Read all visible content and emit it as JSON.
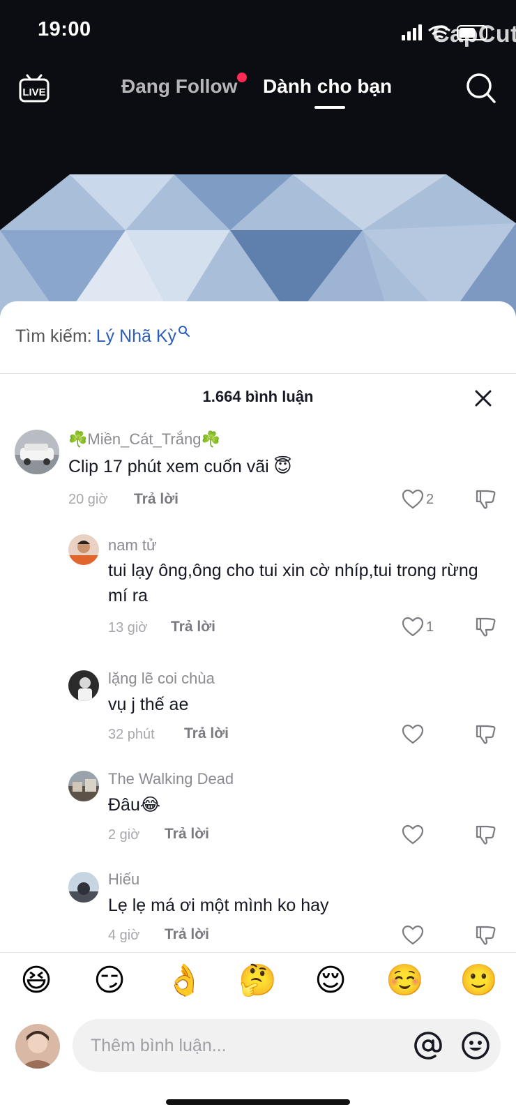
{
  "status_bar": {
    "time": "19:00",
    "watermark": "CapCut"
  },
  "nav": {
    "live_label": "LIVE",
    "tabs": [
      {
        "label": "Đang Follow",
        "active": false,
        "has_dot": true
      },
      {
        "label": "Dành cho bạn",
        "active": true,
        "has_dot": false
      }
    ],
    "icons": [
      "live-tv-icon",
      "search-icon"
    ]
  },
  "search_suggestion": {
    "prefix": "Tìm kiếm:",
    "keyword": "Lý Nhã Kỳ"
  },
  "comments_header": {
    "title": "1.664 bình luận"
  },
  "comments": [
    {
      "user": "☘️Miền_Cát_Trắng☘️",
      "text": "Clip 17 phút xem cuốn vãi 😇",
      "time": "20 giờ",
      "reply_label": "Trả lời",
      "likes": "2",
      "is_reply": false
    },
    {
      "user": "nam tử",
      "text": "tui lạy ông,ông cho tui xin cờ nhíp,tui trong rừng mí ra",
      "time": "13 giờ",
      "reply_label": "Trả lời",
      "likes": "1",
      "is_reply": true
    },
    {
      "user": "lặng lẽ coi chùa",
      "text": "vụ j thế ae",
      "time": "32 phút",
      "reply_label": "Trả lời",
      "likes": "",
      "is_reply": true
    },
    {
      "user": "The Walking Dead",
      "text": "Đâu😂",
      "time": "2 giờ",
      "reply_label": "Trả lời",
      "likes": "",
      "is_reply": true
    },
    {
      "user": "Hiếu",
      "text": "Lẹ lẹ má ơi một mình ko hay",
      "time": "4 giờ",
      "reply_label": "Trả lời",
      "likes": "",
      "is_reply": true
    }
  ],
  "emoji_bar": [
    "😆",
    "😏",
    "👌",
    "🤔",
    "😌",
    "☺️",
    "🙂"
  ],
  "composer": {
    "placeholder": "Thêm bình luận...",
    "icons": [
      "mention-icon",
      "emoji-picker-icon"
    ]
  },
  "colors": {
    "keyword": "#2b5db9",
    "notification_dot": "#fe2c55",
    "text_primary": "#161823",
    "text_secondary": "#8a8b91"
  }
}
